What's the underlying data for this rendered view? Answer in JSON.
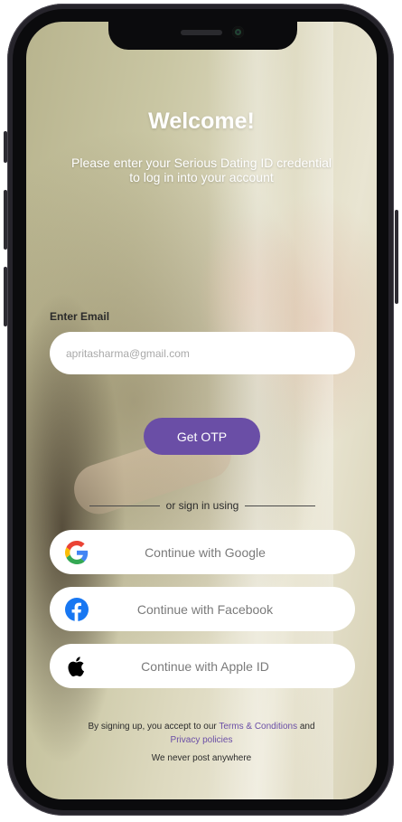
{
  "welcome": {
    "title": "Welcome!",
    "subtitle_line1": "Please enter your Serious Dating ID credential",
    "subtitle_line2": "to log in into your account"
  },
  "email": {
    "label": "Enter Email",
    "value": "apritasharma@gmail.com"
  },
  "otp_button": {
    "label": "Get OTP"
  },
  "divider": {
    "text": "or sign in using"
  },
  "social": [
    {
      "label": "Continue with Google",
      "icon": "google-icon"
    },
    {
      "label": "Continue with Facebook",
      "icon": "facebook-icon"
    },
    {
      "label": "Continue with Apple ID",
      "icon": "apple-icon"
    }
  ],
  "terms": {
    "prefix": "By signing up, you accept to our ",
    "terms_link": "Terms & Conditions",
    "and": " and",
    "privacy_link": "Privacy policies",
    "never_post": "We never post anywhere"
  },
  "colors": {
    "accent": "#6a4ea6",
    "facebook": "#1877f2",
    "google_blue": "#4285f4",
    "google_red": "#ea4335",
    "google_yellow": "#fbbc05",
    "google_green": "#34a853"
  }
}
